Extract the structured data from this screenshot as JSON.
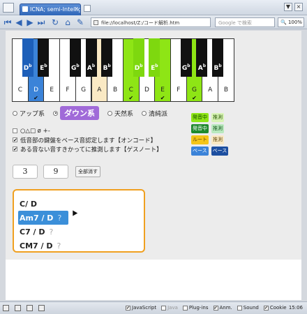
{
  "browser": {
    "tab_title": "ICNA; semi-Intellige...",
    "tab_close": "×",
    "window_buttons": [
      "▼",
      "×"
    ],
    "address": "file://localhost/Z:/コード解析.htm",
    "search_placeholder": "Google で検索",
    "zoom": "100%"
  },
  "piano": {
    "white_keys": [
      {
        "label": "C",
        "state": "none",
        "checked": false
      },
      {
        "label": "D",
        "state": "blue",
        "checked": true
      },
      {
        "label": "E",
        "state": "none",
        "checked": false
      },
      {
        "label": "F",
        "state": "none",
        "checked": false
      },
      {
        "label": "G",
        "state": "none",
        "checked": false
      },
      {
        "label": "A",
        "state": "orange",
        "checked": false
      },
      {
        "label": "B",
        "state": "none",
        "checked": false
      },
      {
        "label": "C",
        "state": "green",
        "checked": true
      },
      {
        "label": "D",
        "state": "none",
        "checked": false
      },
      {
        "label": "E",
        "state": "green",
        "checked": true
      },
      {
        "label": "F",
        "state": "none",
        "checked": false
      },
      {
        "label": "G",
        "state": "green",
        "checked": true
      },
      {
        "label": "A",
        "state": "none",
        "checked": false
      },
      {
        "label": "B",
        "state": "none",
        "checked": false
      }
    ],
    "black_keys": [
      {
        "label": "D",
        "accidental": "b",
        "state": "blue"
      },
      {
        "label": "E",
        "accidental": "b",
        "state": "black"
      },
      {
        "label": "G",
        "accidental": "b",
        "state": "black"
      },
      {
        "label": "A",
        "accidental": "b",
        "state": "black"
      },
      {
        "label": "B",
        "accidental": "b",
        "state": "black"
      },
      {
        "label": "D",
        "accidental": "b",
        "state": "green"
      },
      {
        "label": "E",
        "accidental": "b",
        "state": "green"
      },
      {
        "label": "G",
        "accidental": "b",
        "state": "black"
      },
      {
        "label": "A",
        "accidental": "b",
        "state": "black"
      },
      {
        "label": "B",
        "accidental": "b",
        "state": "black"
      }
    ],
    "check_mark": "✔"
  },
  "modes": {
    "up": "アップ系",
    "down": "ダウン系",
    "natural": "天然系",
    "pure": "清純派"
  },
  "options": {
    "symbols": "○△□ ø +-",
    "oncode": "低音部の鍵盤をベース音認定します【オンコード】",
    "guess": "ある音ない音すきかってに推測します【ゲスノート】"
  },
  "legend": {
    "sounding1": "発音中",
    "guess1": "推測",
    "sounding2": "発音中",
    "guess2": "推測",
    "root": "ルート",
    "guess3": "推測",
    "bass1": "ベース",
    "bass2": "ベース"
  },
  "inputs": {
    "num1": "3",
    "num2": "9",
    "clear": "全部消す"
  },
  "chords": [
    {
      "root": "C",
      "rest": " / D",
      "q": ""
    },
    {
      "root": "A",
      "rest": "m7 / D",
      "q": "?"
    },
    {
      "root": "C",
      "rest": "7 / D",
      "q": "?"
    },
    {
      "root": "C",
      "rest": "M7 / D",
      "q": "?"
    }
  ],
  "statusbar": {
    "javascript": "JavaScript",
    "java": "Java",
    "plugins": "Plug-ins",
    "anm": "Anm.",
    "sound": "Sound",
    "cookie": "Cookie",
    "time": "15:06"
  }
}
